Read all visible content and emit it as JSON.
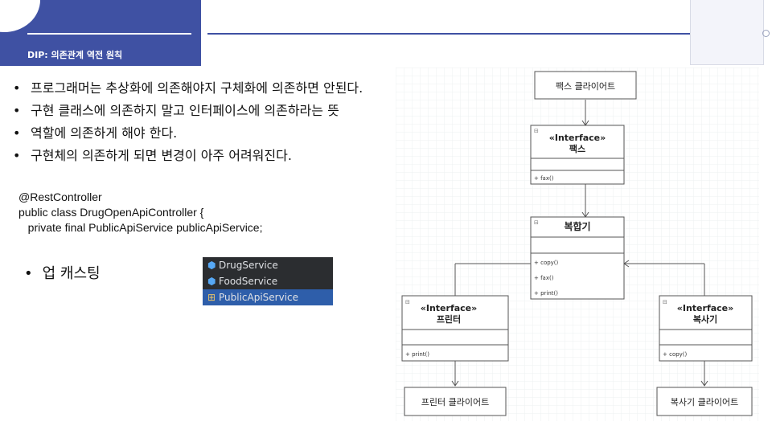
{
  "header": {
    "title": "DIP: 의존관계 역전 원칙"
  },
  "bullets": [
    "프로그래머는 추상화에 의존해야지 구체화에 의존하면 안된다.",
    "구현 클래스에 의존하지 말고 인터페이스에 의존하라는 뜻",
    "역할에 의존하게 해야 한다.",
    "구현체의 의존하게 되면 변경이 아주 어려워진다."
  ],
  "code": {
    "line1": "@RestController",
    "line2": "public class DrugOpenApiController {",
    "line3": "   private final PublicApiService publicApiService;"
  },
  "upcast_label": "업 캐스팅",
  "ide_list": {
    "items": [
      {
        "label": "DrugService",
        "icon": "interface-icon"
      },
      {
        "label": "FoodService",
        "icon": "interface-icon"
      },
      {
        "label": "PublicApiService",
        "icon": "class-tree-icon"
      }
    ],
    "selected_index": 2
  },
  "uml": {
    "fax_client": "팩스 클라이어트",
    "fax_stereotype": "«Interface»",
    "fax_name": "팩스",
    "fax_method": "+ fax()",
    "multi_name": "복합기",
    "multi_methods": [
      "+ copy()",
      "+ fax()",
      "+ print()"
    ],
    "printer_stereotype": "«Interface»",
    "printer_name": "프린터",
    "printer_method": "+ print()",
    "copier_stereotype": "«Interface»",
    "copier_name": "복사기",
    "copier_method": "+ copy()",
    "printer_client": "프린터 클라이어트",
    "copier_client": "복사기 클라이어트"
  }
}
